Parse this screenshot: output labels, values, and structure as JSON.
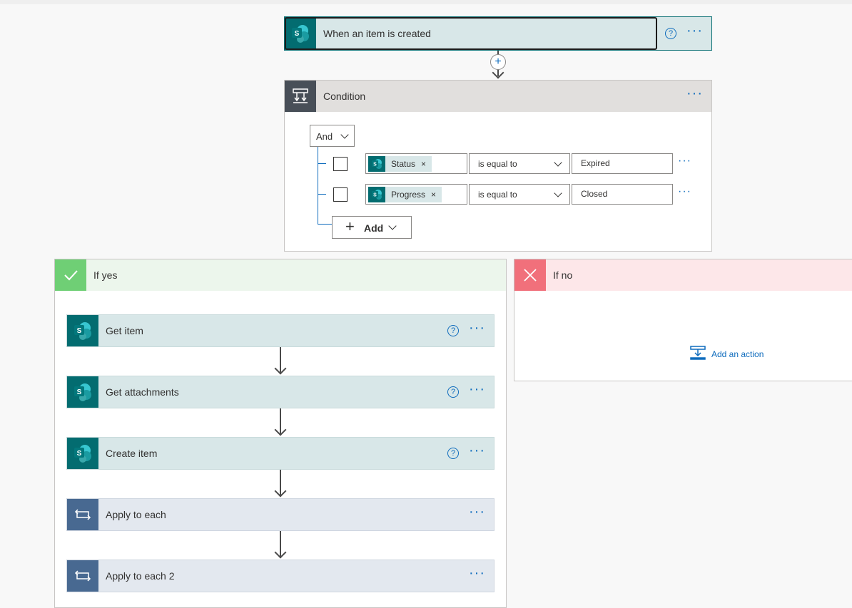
{
  "trigger": {
    "title": "When an item is created",
    "help": "?",
    "more": "···"
  },
  "condition": {
    "title": "Condition",
    "more": "···",
    "group_operator": "And",
    "rows": [
      {
        "token": "Status",
        "operator": "is equal to",
        "value": "Expired"
      },
      {
        "token": "Progress",
        "operator": "is equal to",
        "value": "Closed"
      }
    ],
    "add_label": "Add",
    "row_more": "···"
  },
  "if_yes": {
    "title": "If yes",
    "actions": [
      {
        "title": "Get item",
        "kind": "sharepoint"
      },
      {
        "title": "Get attachments",
        "kind": "sharepoint"
      },
      {
        "title": "Create item",
        "kind": "sharepoint"
      },
      {
        "title": "Apply to each",
        "kind": "loop"
      },
      {
        "title": "Apply to each 2",
        "kind": "loop"
      }
    ]
  },
  "if_no": {
    "title": "If no",
    "add_action": "Add an action"
  },
  "icons": {
    "sharepoint": "sharepoint-icon",
    "loop": "loop-icon",
    "condition": "condition-icon"
  },
  "colors": {
    "sharepoint": "#036c70",
    "loop": "#486991",
    "accent": "#0f6cbd",
    "yes": "#6fcf75",
    "no": "#f1707b"
  }
}
